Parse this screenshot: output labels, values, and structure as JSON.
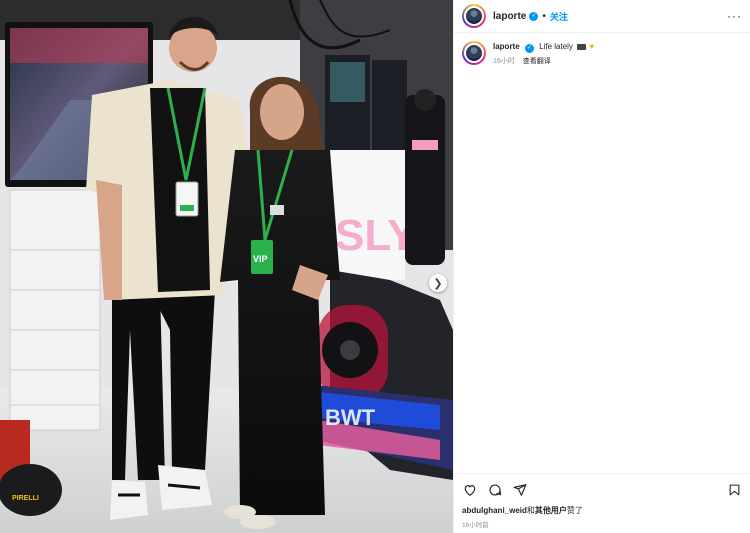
{
  "post": {
    "username": "laporte",
    "follow_label": "关注",
    "separator": "•",
    "more_label": "···",
    "caption_text": "Life lately",
    "caption_time": "16小时",
    "translate_label": "查看翻译",
    "likes_user": "abdulghani_weid",
    "likes_and": "和",
    "likes_others": "其他用户",
    "likes_suffix": "赞了",
    "post_time": "16小时前"
  },
  "photo": {
    "wall_text": "SLY",
    "car_text": "BWT",
    "vip_text": "VIP",
    "brand_text": "PIRELLI"
  },
  "colors": {
    "verified": "#0095f6",
    "follow": "#0095f6",
    "muted": "#8e8e8e",
    "wall_pink": "#f4a6c8",
    "car_blue": "#1f4bd8",
    "lanyard_green": "#2bb24c"
  },
  "icons": {
    "like": "heart-icon",
    "comment": "comment-icon",
    "share": "share-icon",
    "save": "bookmark-icon",
    "next": "chevron-right-icon"
  }
}
